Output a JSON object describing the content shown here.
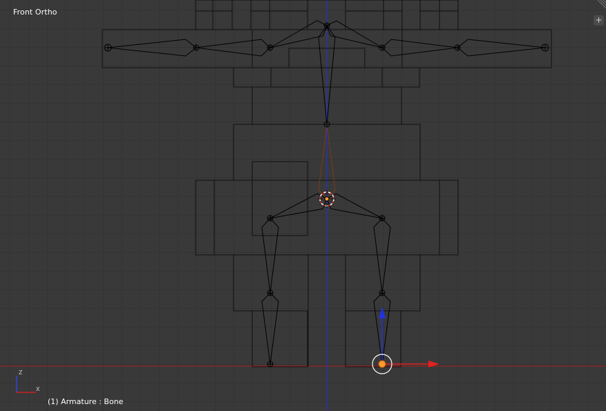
{
  "viewport": {
    "view_name": "Front Ortho",
    "status": "(1) Armature : Bone",
    "axis_labels": {
      "z": "Z",
      "x": "X"
    },
    "toolshelf_toggle": "+"
  },
  "colors": {
    "background": "#393939",
    "grid": "#333333",
    "wire": "#111111",
    "x_axis": "#b01c1c",
    "z_axis": "#2633cc",
    "selected": "#ff9a2e",
    "active": "#ffffff"
  },
  "icons": {
    "corner": "resize-corner-icon",
    "plus": "plus-icon",
    "cursor": "3d-cursor-icon",
    "gizmo": "translate-gizmo-icon",
    "axis": "axis-orientation-icon"
  }
}
